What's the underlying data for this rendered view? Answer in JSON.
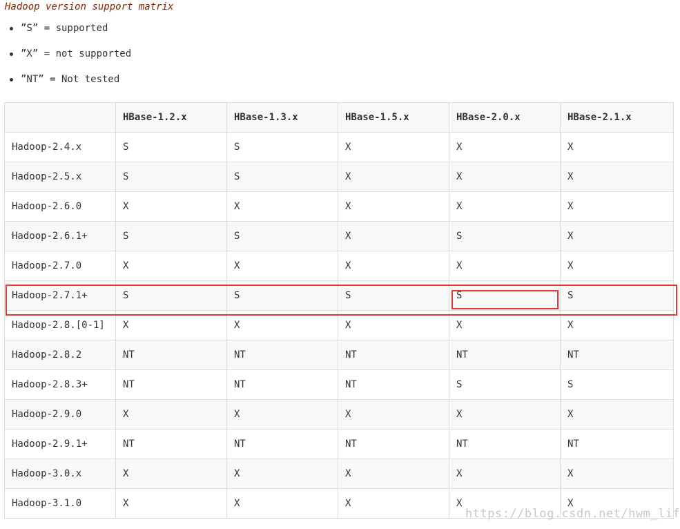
{
  "caption": "Hadoop version support matrix",
  "legend": [
    "”S” = supported",
    "”X” = not supported",
    "”NT” = Not tested"
  ],
  "table": {
    "headers": [
      "",
      "HBase-1.2.x",
      "HBase-1.3.x",
      "HBase-1.5.x",
      "HBase-2.0.x",
      "HBase-2.1.x"
    ],
    "rows": [
      [
        "Hadoop-2.4.x",
        "S",
        "S",
        "X",
        "X",
        "X"
      ],
      [
        "Hadoop-2.5.x",
        "S",
        "S",
        "X",
        "X",
        "X"
      ],
      [
        "Hadoop-2.6.0",
        "X",
        "X",
        "X",
        "X",
        "X"
      ],
      [
        "Hadoop-2.6.1+",
        "S",
        "S",
        "X",
        "S",
        "X"
      ],
      [
        "Hadoop-2.7.0",
        "X",
        "X",
        "X",
        "X",
        "X"
      ],
      [
        "Hadoop-2.7.1+",
        "S",
        "S",
        "S",
        "S",
        "S"
      ],
      [
        "Hadoop-2.8.[0-1]",
        "X",
        "X",
        "X",
        "X",
        "X"
      ],
      [
        "Hadoop-2.8.2",
        "NT",
        "NT",
        "NT",
        "NT",
        "NT"
      ],
      [
        "Hadoop-2.8.3+",
        "NT",
        "NT",
        "NT",
        "S",
        "S"
      ],
      [
        "Hadoop-2.9.0",
        "X",
        "X",
        "X",
        "X",
        "X"
      ],
      [
        "Hadoop-2.9.1+",
        "NT",
        "NT",
        "NT",
        "NT",
        "NT"
      ],
      [
        "Hadoop-3.0.x",
        "X",
        "X",
        "X",
        "X",
        "X"
      ],
      [
        "Hadoop-3.1.0",
        "X",
        "X",
        "X",
        "X",
        "X"
      ]
    ]
  },
  "watermark": "https://blog.csdn.net/hwm_life",
  "colors": {
    "caption": "#8b2500",
    "highlight": "#e53935",
    "border": "#dddddd",
    "stripe": "#f8f8f8"
  }
}
